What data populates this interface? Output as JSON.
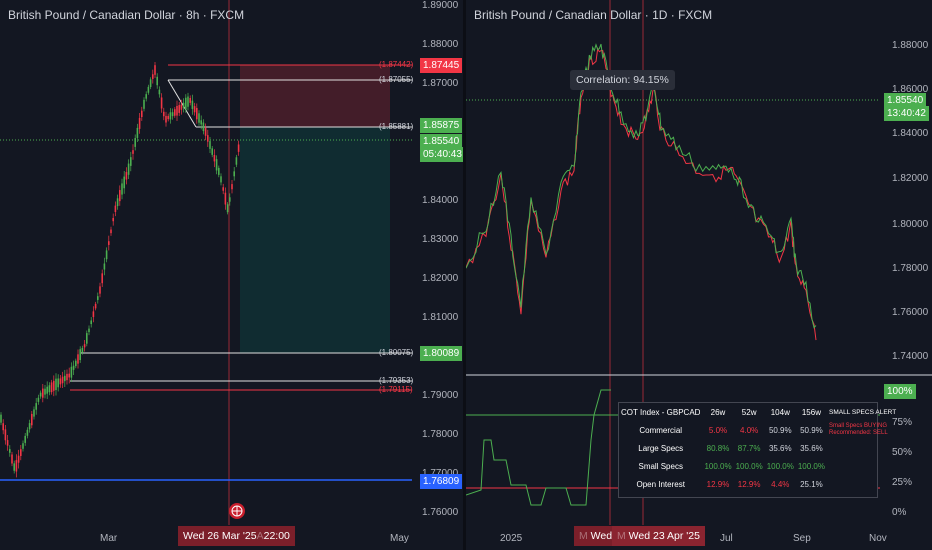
{
  "left_chart": {
    "title": "British Pound / Canadian Dollar · 8h · FXCM",
    "y_ticks": [
      "1.89000",
      "1.88000",
      "1.87000",
      "1.84000",
      "1.83000",
      "1.82000",
      "1.81000",
      "1.79000",
      "1.78000",
      "1.77000",
      "1.76000"
    ],
    "x_ticks": [
      "Mar",
      "May"
    ],
    "levels": {
      "l1": "(1.87442)",
      "l2": "(1.87055)",
      "l3": "(1.85881)",
      "l4": "(1.80075)",
      "l5": "(1.79353)",
      "l6": "(1.79115)"
    },
    "badges": {
      "target": "1.87445",
      "entry": "1.85875",
      "current_price": "1.85540",
      "countdown": "05:40:43",
      "stop": "1.80089",
      "blue": "1.76809"
    },
    "date_badge": "Wed 26 Mar '25",
    "date_badge_time": "22:00",
    "date_badge_ghost": "A",
    "colors": {
      "red": "#f23645",
      "green": "#4caf50",
      "blue": "#2962ff",
      "up": "#4caf50",
      "down": "#f23645"
    }
  },
  "right_chart": {
    "title": "British Pound / Canadian Dollar · 1D · FXCM",
    "y_ticks": [
      "1.88000",
      "1.86000",
      "1.84000",
      "1.82000",
      "1.80000",
      "1.78000",
      "1.76000",
      "1.74000"
    ],
    "pct_ticks": [
      "100%",
      "75%",
      "50%",
      "25%",
      "0%"
    ],
    "x_ticks": [
      "2025",
      "Jul",
      "Sep",
      "Nov"
    ],
    "badges": {
      "current_price": "1.85540",
      "countdown": "13:40:42",
      "pct": "100%"
    },
    "date_badge_1": "Wed 26",
    "date_badge_2": "Wed 23 Apr '25",
    "date_badge_ghost_1": "M",
    "date_badge_ghost_2": "M",
    "correlation": "Correlation: 94.15%",
    "cot": {
      "headers": [
        "COT Index - GBPCAD",
        "26w",
        "52w",
        "104w",
        "156w",
        "SMALL SPECS ALERT"
      ],
      "rows": [
        {
          "label": "Commercial",
          "values": [
            "5.0%",
            "4.0%",
            "50.9%",
            "50.9%"
          ],
          "colors": [
            "red",
            "red",
            "white",
            "white"
          ]
        },
        {
          "label": "Large Specs",
          "values": [
            "80.8%",
            "87.7%",
            "35.6%",
            "35.6%"
          ],
          "colors": [
            "green",
            "green",
            "white",
            "white"
          ]
        },
        {
          "label": "Small Specs",
          "values": [
            "100.0%",
            "100.0%",
            "100.0%",
            "100.0%"
          ],
          "colors": [
            "green",
            "green",
            "green",
            "green"
          ]
        },
        {
          "label": "Open Interest",
          "values": [
            "12.9%",
            "12.9%",
            "4.4%",
            "25.1%"
          ],
          "colors": [
            "red",
            "red",
            "red",
            "white"
          ]
        }
      ],
      "alert_line1": "Small Specs BUYING",
      "alert_line2": "Recommended: SELL"
    }
  }
}
